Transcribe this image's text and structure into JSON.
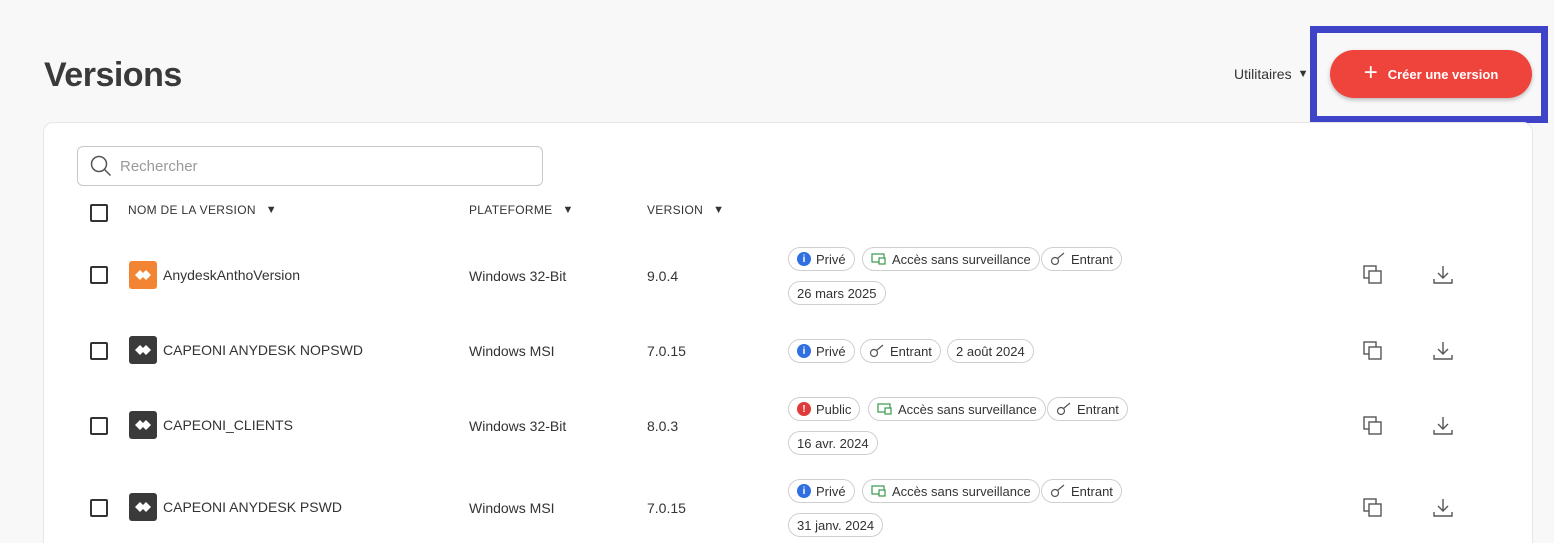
{
  "page": {
    "title": "Versions",
    "utilities_label": "Utilitaires",
    "create_label": "Créer une version"
  },
  "colors": {
    "accent": "#ef443b",
    "highlight": "#3e43c8",
    "private_dot": "#2f6fe0",
    "public_dot": "#e03a3a",
    "anydesk_orange": "#f28433",
    "anydesk_dark": "#3a3a3a"
  },
  "search": {
    "placeholder": "Rechercher"
  },
  "table": {
    "columns": [
      "NOM DE LA VERSION",
      "PLATEFORME",
      "VERSION"
    ],
    "rows": [
      {
        "name": "AnydeskAnthoVersion",
        "icon": "anydesk-orange-icon",
        "platform": "Windows 32-Bit",
        "version": "9.0.4",
        "visibility": "Privé",
        "unattended": "Accès sans surveillance",
        "incoming": "Entrant",
        "date": "26 mars 2025"
      },
      {
        "name": "CAPEONI ANYDESK NOPSWD",
        "icon": "anydesk-dark-icon",
        "platform": "Windows MSI",
        "version": "7.0.15",
        "visibility": "Privé",
        "incoming": "Entrant",
        "date": "2 août 2024"
      },
      {
        "name": "CAPEONI_CLIENTS",
        "icon": "anydesk-dark-icon",
        "platform": "Windows 32-Bit",
        "version": "8.0.3",
        "visibility": "Public",
        "unattended": "Accès sans surveillance",
        "incoming": "Entrant",
        "date": "16 avr. 2024"
      },
      {
        "name": "CAPEONI ANYDESK PSWD",
        "icon": "anydesk-dark-icon",
        "platform": "Windows MSI",
        "version": "7.0.15",
        "visibility": "Privé",
        "unattended": "Accès sans surveillance",
        "incoming": "Entrant",
        "date": "31 janv. 2024"
      }
    ]
  }
}
